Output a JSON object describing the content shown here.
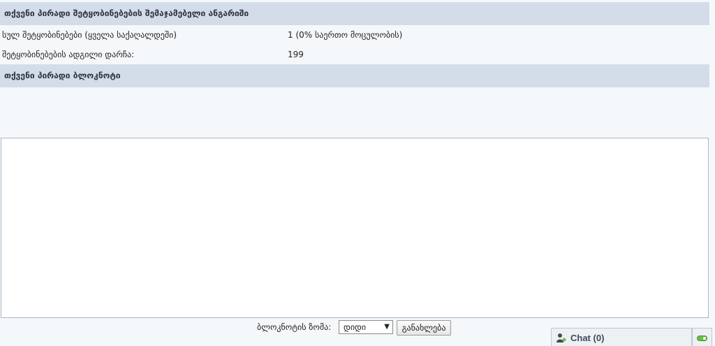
{
  "summary": {
    "title": "თქვენი პირადი შეტყობინებების შემაჯამებელი ანგარიში",
    "rows": [
      {
        "label": "სულ შეტყობინებები (ყველა საქაღალდეში)",
        "value": "1 (0% საერთო მოცულობის)"
      },
      {
        "label": "შეტყობინებების ადგილი დარჩა:",
        "value": "199"
      }
    ]
  },
  "notepad": {
    "title": "თქვენი პირადი ბლოკნოტი",
    "content": ""
  },
  "size_controls": {
    "label": "ბლოკნოტის ზომა:",
    "selected": "დიდი",
    "button": "განახლება"
  },
  "chat": {
    "label": "Chat",
    "count": "(0)",
    "status_color": "#6abf4b",
    "icon": "person-icon"
  },
  "colors": {
    "section_header": "#d3dde9",
    "page_bg": "#f5f8fb"
  }
}
